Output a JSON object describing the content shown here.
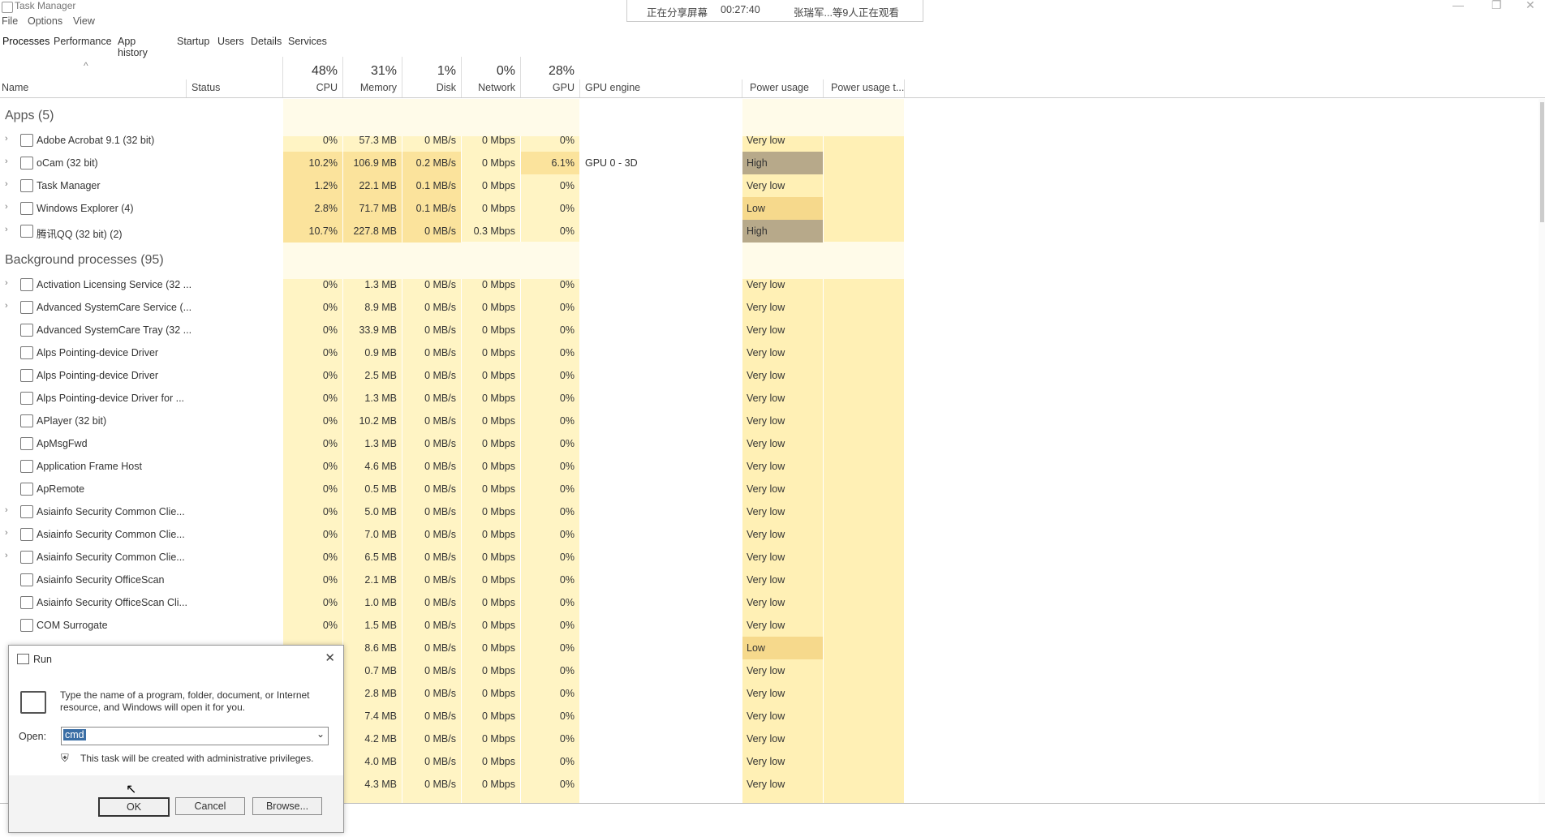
{
  "window": {
    "title": "Task Manager"
  },
  "menu": [
    "File",
    "Options",
    "View"
  ],
  "share_bar": {
    "status": "正在分享屏幕",
    "time": "00:27:40",
    "viewers": "张瑞军...等9人正在观看"
  },
  "tabs": [
    "Processes",
    "Performance",
    "App history",
    "Startup",
    "Users",
    "Details",
    "Services"
  ],
  "columns": {
    "name": "Name",
    "status": "Status",
    "cpu": {
      "pct": "48%",
      "label": "CPU"
    },
    "memory": {
      "pct": "31%",
      "label": "Memory"
    },
    "disk": {
      "pct": "1%",
      "label": "Disk"
    },
    "network": {
      "pct": "0%",
      "label": "Network"
    },
    "gpu": {
      "pct": "28%",
      "label": "GPU"
    },
    "gpu_engine": "GPU engine",
    "power": "Power usage",
    "power_trend": "Power usage t..."
  },
  "groups": {
    "apps": "Apps (5)",
    "background": "Background processes (95)"
  },
  "apps": [
    {
      "name": "Adobe Acrobat 9.1 (32 bit)",
      "cpu": "0%",
      "mem": "57.3 MB",
      "disk": "0 MB/s",
      "net": "0 Mbps",
      "gpu": "0%",
      "engine": "",
      "power": "Very low",
      "icon": "acrobat-icon"
    },
    {
      "name": "oCam (32 bit)",
      "cpu": "10.2%",
      "mem": "106.9 MB",
      "disk": "0.2 MB/s",
      "net": "0 Mbps",
      "gpu": "6.1%",
      "engine": "GPU 0 - 3D",
      "power": "High",
      "icon": "ocam-icon"
    },
    {
      "name": "Task Manager",
      "cpu": "1.2%",
      "mem": "22.1 MB",
      "disk": "0.1 MB/s",
      "net": "0 Mbps",
      "gpu": "0%",
      "engine": "",
      "power": "Very low",
      "icon": "task-manager-icon"
    },
    {
      "name": "Windows Explorer (4)",
      "cpu": "2.8%",
      "mem": "71.7 MB",
      "disk": "0.1 MB/s",
      "net": "0 Mbps",
      "gpu": "0%",
      "engine": "",
      "power": "Low",
      "icon": "folder-icon"
    },
    {
      "name": "腾讯QQ (32 bit) (2)",
      "cpu": "10.7%",
      "mem": "227.8 MB",
      "disk": "0 MB/s",
      "net": "0.3 Mbps",
      "gpu": "0%",
      "engine": "",
      "power": "High",
      "icon": "qq-icon"
    }
  ],
  "background": [
    {
      "name": "Activation Licensing Service (32 ...",
      "cpu": "0%",
      "mem": "1.3 MB",
      "disk": "0 MB/s",
      "net": "0 Mbps",
      "gpu": "0%",
      "power": "Very low",
      "expand": true
    },
    {
      "name": "Advanced SystemCare Service (...",
      "cpu": "0%",
      "mem": "8.9 MB",
      "disk": "0 MB/s",
      "net": "0 Mbps",
      "gpu": "0%",
      "power": "Very low",
      "expand": true
    },
    {
      "name": "Advanced SystemCare Tray (32 ...",
      "cpu": "0%",
      "mem": "33.9 MB",
      "disk": "0 MB/s",
      "net": "0 Mbps",
      "gpu": "0%",
      "power": "Very low",
      "expand": false
    },
    {
      "name": "Alps Pointing-device Driver",
      "cpu": "0%",
      "mem": "0.9 MB",
      "disk": "0 MB/s",
      "net": "0 Mbps",
      "gpu": "0%",
      "power": "Very low",
      "expand": false
    },
    {
      "name": "Alps Pointing-device Driver",
      "cpu": "0%",
      "mem": "2.5 MB",
      "disk": "0 MB/s",
      "net": "0 Mbps",
      "gpu": "0%",
      "power": "Very low",
      "expand": false
    },
    {
      "name": "Alps Pointing-device Driver for ...",
      "cpu": "0%",
      "mem": "1.3 MB",
      "disk": "0 MB/s",
      "net": "0 Mbps",
      "gpu": "0%",
      "power": "Very low",
      "expand": false
    },
    {
      "name": "APlayer (32 bit)",
      "cpu": "0%",
      "mem": "10.2 MB",
      "disk": "0 MB/s",
      "net": "0 Mbps",
      "gpu": "0%",
      "power": "Very low",
      "expand": false
    },
    {
      "name": "ApMsgFwd",
      "cpu": "0%",
      "mem": "1.3 MB",
      "disk": "0 MB/s",
      "net": "0 Mbps",
      "gpu": "0%",
      "power": "Very low",
      "expand": false
    },
    {
      "name": "Application Frame Host",
      "cpu": "0%",
      "mem": "4.6 MB",
      "disk": "0 MB/s",
      "net": "0 Mbps",
      "gpu": "0%",
      "power": "Very low",
      "expand": false
    },
    {
      "name": "ApRemote",
      "cpu": "0%",
      "mem": "0.5 MB",
      "disk": "0 MB/s",
      "net": "0 Mbps",
      "gpu": "0%",
      "power": "Very low",
      "expand": false
    },
    {
      "name": "Asiainfo Security Common Clie...",
      "cpu": "0%",
      "mem": "5.0 MB",
      "disk": "0 MB/s",
      "net": "0 Mbps",
      "gpu": "0%",
      "power": "Very low",
      "expand": true
    },
    {
      "name": "Asiainfo Security Common Clie...",
      "cpu": "0%",
      "mem": "7.0 MB",
      "disk": "0 MB/s",
      "net": "0 Mbps",
      "gpu": "0%",
      "power": "Very low",
      "expand": true
    },
    {
      "name": "Asiainfo Security Common Clie...",
      "cpu": "0%",
      "mem": "6.5 MB",
      "disk": "0 MB/s",
      "net": "0 Mbps",
      "gpu": "0%",
      "power": "Very low",
      "expand": true
    },
    {
      "name": "Asiainfo Security OfficeScan",
      "cpu": "0%",
      "mem": "2.1 MB",
      "disk": "0 MB/s",
      "net": "0 Mbps",
      "gpu": "0%",
      "power": "Very low",
      "expand": false
    },
    {
      "name": "Asiainfo Security OfficeScan Cli...",
      "cpu": "0%",
      "mem": "1.0 MB",
      "disk": "0 MB/s",
      "net": "0 Mbps",
      "gpu": "0%",
      "power": "Very low",
      "expand": false
    },
    {
      "name": "COM Surrogate",
      "cpu": "0%",
      "mem": "1.5 MB",
      "disk": "0 MB/s",
      "net": "0 Mbps",
      "gpu": "0%",
      "power": "Very low",
      "expand": false
    },
    {
      "name": "",
      "cpu": "",
      "mem": "8.6 MB",
      "disk": "0 MB/s",
      "net": "0 Mbps",
      "gpu": "0%",
      "power": "Low",
      "expand": false
    },
    {
      "name": "",
      "cpu": "",
      "mem": "0.7 MB",
      "disk": "0 MB/s",
      "net": "0 Mbps",
      "gpu": "0%",
      "power": "Very low",
      "expand": false
    },
    {
      "name": "",
      "cpu": "",
      "mem": "2.8 MB",
      "disk": "0 MB/s",
      "net": "0 Mbps",
      "gpu": "0%",
      "power": "Very low",
      "expand": false
    },
    {
      "name": "",
      "cpu": "",
      "mem": "7.4 MB",
      "disk": "0 MB/s",
      "net": "0 Mbps",
      "gpu": "0%",
      "power": "Very low",
      "expand": false
    },
    {
      "name": "",
      "cpu": "",
      "mem": "4.2 MB",
      "disk": "0 MB/s",
      "net": "0 Mbps",
      "gpu": "0%",
      "power": "Very low",
      "expand": false
    },
    {
      "name": "",
      "cpu": "",
      "mem": "4.0 MB",
      "disk": "0 MB/s",
      "net": "0 Mbps",
      "gpu": "0%",
      "power": "Very low",
      "expand": false
    },
    {
      "name": "",
      "cpu": "",
      "mem": "4.3 MB",
      "disk": "0 MB/s",
      "net": "0 Mbps",
      "gpu": "0%",
      "power": "Very low",
      "expand": false
    }
  ],
  "run_dialog": {
    "title": "Run",
    "description": "Type the name of a program, folder, document, or Internet resource, and Windows will open it for you.",
    "open_label": "Open:",
    "open_value": "cmd",
    "admin_note": "This task will be created with administrative privileges.",
    "ok": "OK",
    "cancel": "Cancel",
    "browse": "Browse..."
  },
  "colors": {
    "cpu_fill": "#fff4c4",
    "high": "#b7a98a",
    "low": "#f6d98c",
    "accent": "#3a6ea5"
  }
}
